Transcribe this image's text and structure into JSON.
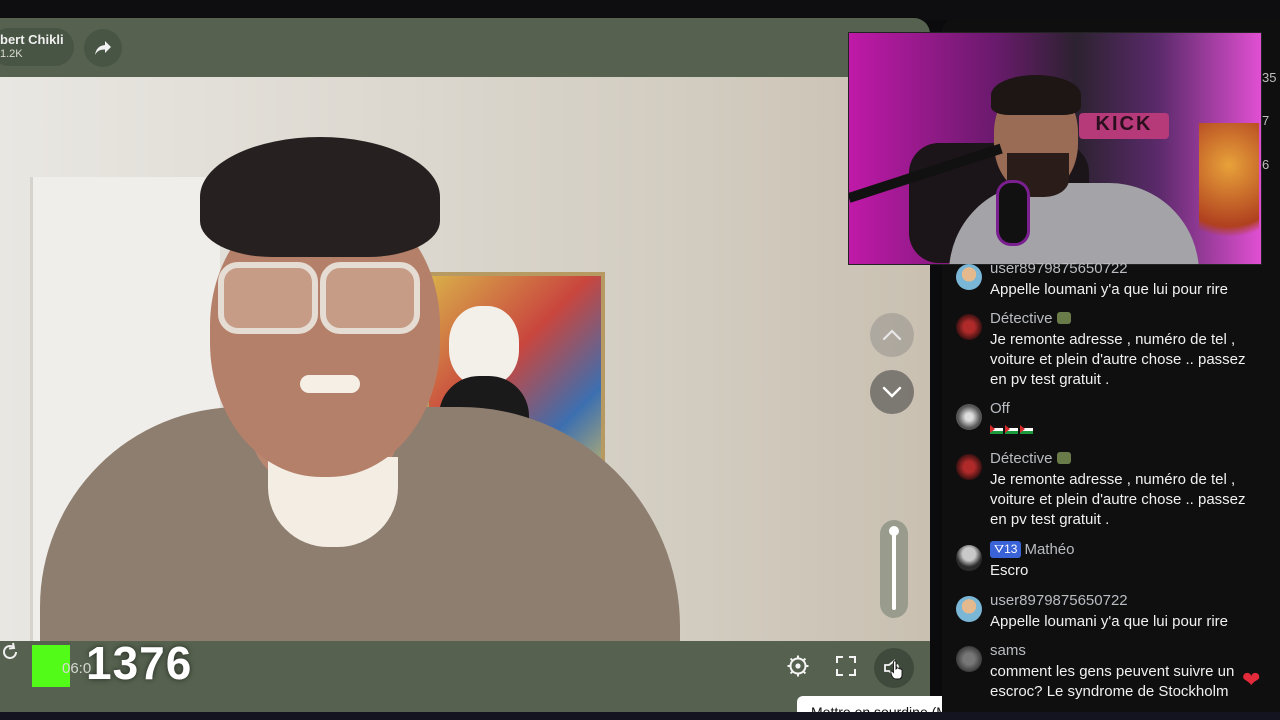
{
  "host": {
    "name": "bert Chikli",
    "followers": "1.2K"
  },
  "player": {
    "timer": "06:0",
    "viewer_count": "1376",
    "tooltip": "Mettre en sourdine (M)",
    "volume_level": 0.95
  },
  "side_numbers": [
    "35",
    "7",
    "6"
  ],
  "webcam": {
    "sign_text": "KICK"
  },
  "chat": {
    "messages": [
      {
        "user": "user8979875650722",
        "text": "Appelle loumani y'a que lui pour rire",
        "avatar": "cartoon-avatar"
      },
      {
        "user": "Détective",
        "text": "Je remonte adresse , numéro de tel , voiture et plein d'autre chose .. passez en pv test gratuit .",
        "avatar": "detective-avatar"
      },
      {
        "user": "Off",
        "text": "",
        "avatar": "off-avatar",
        "emoji": [
          "palestine-flag",
          "palestine-flag",
          "palestine-flag"
        ]
      },
      {
        "user": "Détective",
        "text": "Je remonte adresse , numéro de tel , voiture et plein d'autre chose .. passez en pv test gratuit .",
        "avatar": "detective-avatar"
      },
      {
        "user": "Mathéo",
        "badge": "13",
        "text": "Escro",
        "avatar": "matheo-avatar"
      },
      {
        "user": "user8979875650722",
        "text": "Appelle loumani y'a que lui pour rire",
        "avatar": "cartoon-avatar"
      },
      {
        "user": "sams",
        "text": "comment les gens peuvent suivre un escroc? Le syndrome de Stockholm",
        "avatar": "sams-avatar"
      }
    ]
  },
  "colors": {
    "panel": "#56624f",
    "kick_green": "#53fc18",
    "chat_bg": "#0f0f10",
    "heart": "#e32a3a"
  }
}
